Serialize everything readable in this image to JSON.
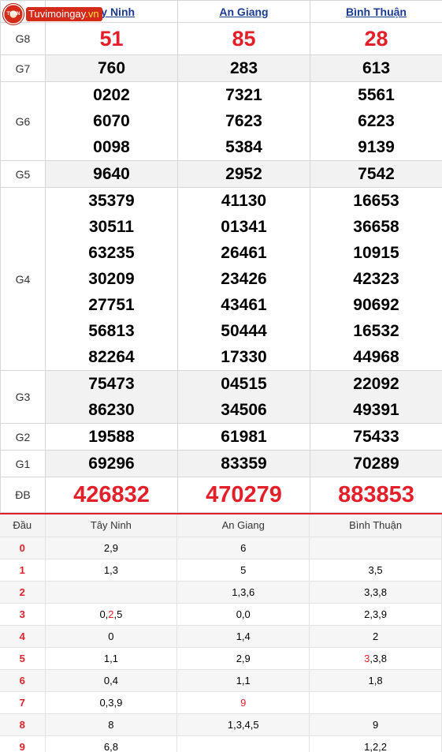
{
  "logo": {
    "badge_text": "TVMN",
    "site_name": "Tuvimoingay",
    "site_suffix": ".vn"
  },
  "provinces": [
    "Tây Ninh",
    "An Giang",
    "Bình Thuận"
  ],
  "prizes": {
    "g8": {
      "label": "G8",
      "values": [
        "51",
        "85",
        "28"
      ]
    },
    "g7": {
      "label": "G7",
      "values": [
        "760",
        "283",
        "613"
      ]
    },
    "g6": {
      "label": "G6",
      "values": [
        [
          "0202",
          "6070",
          "0098"
        ],
        [
          "7321",
          "7623",
          "5384"
        ],
        [
          "5561",
          "6223",
          "9139"
        ]
      ]
    },
    "g5": {
      "label": "G5",
      "values": [
        "9640",
        "2952",
        "7542"
      ]
    },
    "g4": {
      "label": "G4",
      "values": [
        [
          "35379",
          "30511",
          "63235",
          "30209",
          "27751",
          "56813",
          "82264"
        ],
        [
          "41130",
          "01341",
          "26461",
          "23426",
          "43461",
          "50444",
          "17330"
        ],
        [
          "16653",
          "36658",
          "10915",
          "42323",
          "90692",
          "16532",
          "44968"
        ]
      ]
    },
    "g3": {
      "label": "G3",
      "values": [
        [
          "75473",
          "86230"
        ],
        [
          "04515",
          "34506"
        ],
        [
          "22092",
          "49391"
        ]
      ]
    },
    "g2": {
      "label": "G2",
      "values": [
        "19588",
        "61981",
        "75433"
      ]
    },
    "g1": {
      "label": "G1",
      "values": [
        "69296",
        "83359",
        "70289"
      ]
    },
    "db": {
      "label": "ĐB",
      "values": [
        "426832",
        "470279",
        "883853"
      ]
    }
  },
  "dau_table": {
    "header": "Đầu",
    "columns": [
      "Tây Ninh",
      "An Giang",
      "Bình Thuận"
    ],
    "rows": [
      {
        "key": "0",
        "cells": [
          [
            {
              "t": "2,9"
            }
          ],
          [
            {
              "t": "6"
            }
          ],
          [
            {
              "t": ""
            }
          ]
        ]
      },
      {
        "key": "1",
        "cells": [
          [
            {
              "t": "1,3"
            }
          ],
          [
            {
              "t": "5"
            }
          ],
          [
            {
              "t": "3,5"
            }
          ]
        ]
      },
      {
        "key": "2",
        "cells": [
          [
            {
              "t": ""
            }
          ],
          [
            {
              "t": "1,3,6"
            }
          ],
          [
            {
              "t": "3,3,8"
            }
          ]
        ]
      },
      {
        "key": "3",
        "cells": [
          [
            {
              "t": "0,"
            },
            {
              "t": "2",
              "hl": true
            },
            {
              "t": ",5"
            }
          ],
          [
            {
              "t": "0,0"
            }
          ],
          [
            {
              "t": "2,3,9"
            }
          ]
        ]
      },
      {
        "key": "4",
        "cells": [
          [
            {
              "t": "0"
            }
          ],
          [
            {
              "t": "1,4"
            }
          ],
          [
            {
              "t": "2"
            }
          ]
        ]
      },
      {
        "key": "5",
        "cells": [
          [
            {
              "t": "1,1"
            }
          ],
          [
            {
              "t": "2,9"
            }
          ],
          [
            {
              "t": "3",
              "hl": true
            },
            {
              "t": ",3,8"
            }
          ]
        ]
      },
      {
        "key": "6",
        "cells": [
          [
            {
              "t": "0,4"
            }
          ],
          [
            {
              "t": "1,1"
            }
          ],
          [
            {
              "t": "1,8"
            }
          ]
        ]
      },
      {
        "key": "7",
        "cells": [
          [
            {
              "t": "0,3,9"
            }
          ],
          [
            {
              "t": "9",
              "hl": true
            }
          ],
          [
            {
              "t": ""
            }
          ]
        ]
      },
      {
        "key": "8",
        "cells": [
          [
            {
              "t": "8"
            }
          ],
          [
            {
              "t": "1,3,4,5"
            }
          ],
          [
            {
              "t": "9"
            }
          ]
        ]
      },
      {
        "key": "9",
        "cells": [
          [
            {
              "t": "6,8"
            }
          ],
          [
            {
              "t": ""
            }
          ],
          [
            {
              "t": "1,2,2"
            }
          ]
        ]
      }
    ]
  },
  "colors": {
    "accent_red": "#e3202a",
    "link_blue": "#1a3b8f"
  },
  "icons": {
    "logo": "lottery-badge-icon"
  }
}
